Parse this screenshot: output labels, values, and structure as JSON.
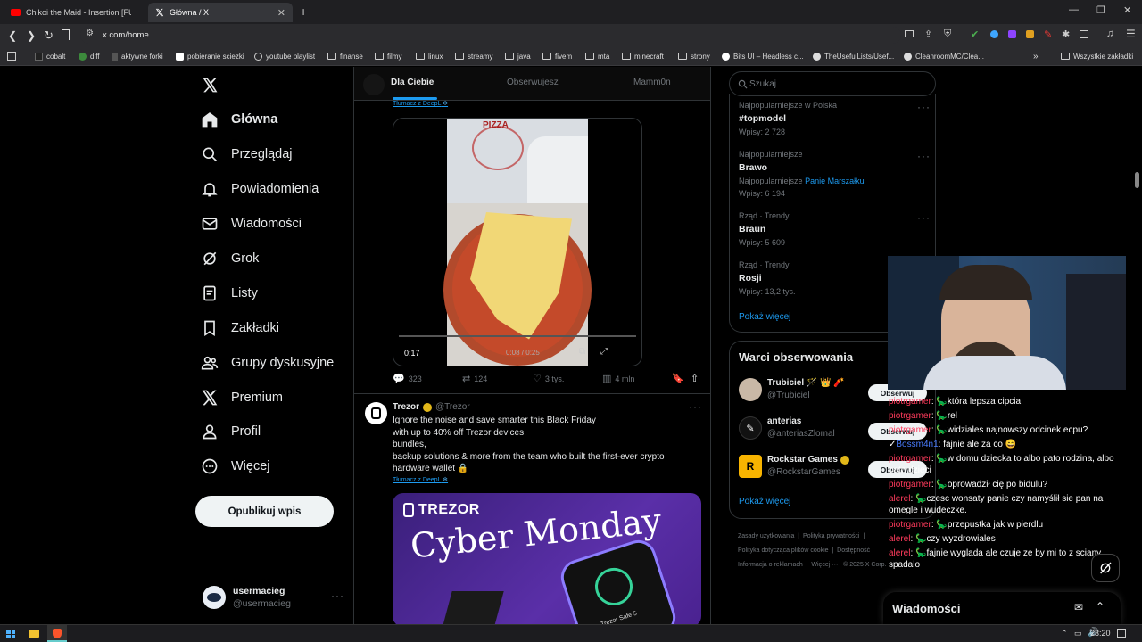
{
  "browser": {
    "tabs": [
      {
        "label": "Chikoi the Maid - Insertion [FULL",
        "icon": "youtube-icon",
        "active": false
      },
      {
        "label": "Główna / X",
        "icon": "x-logo-icon",
        "active": true
      }
    ],
    "url": "x.com/home",
    "bookmarks": [
      "cobalt",
      "diff",
      "aktywne forki",
      "pobieranie sciezki",
      "youtube playlist",
      "finanse",
      "filmy",
      "linux",
      "streamy",
      "java",
      "fivem",
      "mta",
      "minecraft",
      "strony",
      "Bits UI – Headless c...",
      "TheUsefulLists/Usef...",
      "CleanroomMC/Clea..."
    ],
    "all_bookmarks": "Wszystkie zakładki"
  },
  "sidebar": {
    "items": [
      {
        "label": "Główna",
        "icon": "home-icon"
      },
      {
        "label": "Przeglądaj",
        "icon": "search-icon"
      },
      {
        "label": "Powiadomienia",
        "icon": "bell-icon"
      },
      {
        "label": "Wiadomości",
        "icon": "mail-icon"
      },
      {
        "label": "Grok",
        "icon": "grok-icon"
      },
      {
        "label": "Listy",
        "icon": "list-icon"
      },
      {
        "label": "Zakładki",
        "icon": "bookmark-icon"
      },
      {
        "label": "Grupy dyskusyjne",
        "icon": "people-icon"
      },
      {
        "label": "Premium",
        "icon": "x-logo-icon"
      },
      {
        "label": "Profil",
        "icon": "person-icon"
      },
      {
        "label": "Więcej",
        "icon": "more-circle-icon"
      }
    ],
    "post_button": "Opublikuj wpis",
    "account": {
      "name": "usermacieg",
      "handle": "@usermacieg"
    }
  },
  "feed": {
    "tabs": [
      "Dla Ciebie",
      "Obserwujesz",
      "Mamm0n"
    ],
    "translate_label": "Tłumacz z DeepL",
    "video": {
      "time": "0:17",
      "time_right": "0:08 / 0:25",
      "pizza_sign": "PIZZA"
    },
    "stats": {
      "replies": "323",
      "reposts": "124",
      "likes": "3 tys.",
      "views": "4 mln"
    },
    "tweet": {
      "name": "Trezor",
      "handle": "@Trezor",
      "lines": [
        "Ignore the noise and save smarter this Black Friday",
        "with up to 40% off Trezor devices,",
        "bundles,",
        "backup solutions & more from the team who built the first-ever crypto",
        "hardware wallet 🔒"
      ],
      "image_brand": "TREZOR",
      "image_title": "Cyber Monday",
      "device_label": "Trezor Safe 5"
    }
  },
  "right": {
    "search_placeholder": "Szukaj",
    "trends": [
      {
        "meta": "Najpopularniejsze w Polska",
        "name": "#topmodel",
        "count": "Wpisy: 2 728",
        "extra_label": "",
        "extra": ""
      },
      {
        "meta": "Najpopularniejsze",
        "name": "Brawo",
        "count": "Wpisy: 6 194",
        "extra_label": "Najpopularniejsze",
        "extra": "Panie Marszałku"
      },
      {
        "meta": "Rząd · Trendy",
        "name": "Braun",
        "count": "Wpisy: 5 609",
        "extra_label": "",
        "extra": ""
      },
      {
        "meta": "Rząd · Trendy",
        "name": "Rosji",
        "count": "Wpisy: 13,2 tys.",
        "extra_label": "",
        "extra": ""
      }
    ],
    "show_more": "Pokaż więcej",
    "who_to_follow_title": "Warci obserwowania",
    "follow": [
      {
        "name": "Trubiciel 🪄 👑 🧨",
        "handle": "@Trubiciel",
        "button": "Obserwuj"
      },
      {
        "name": "anterias",
        "handle": "@anteriasZlomal",
        "button": "Obserwuj"
      },
      {
        "name": "Rockstar Games",
        "handle": "@RockstarGames",
        "button": "Obserwuj"
      }
    ],
    "show_more2": "Pokaż więcej",
    "footer": [
      "Zasady użytkowania",
      "Polityka prywatności",
      "Polityka dotycząca plików cookie",
      "Dostępność",
      "Informacja o reklamach",
      "Więcej ···",
      "© 2025 X Corp."
    ]
  },
  "chat": {
    "lines": [
      {
        "user": "piotrgamer",
        "color": "#ff3b5c",
        "text": "która lepsza cipcia"
      },
      {
        "user": "piotrgamer",
        "color": "#ff3b5c",
        "text": "rel"
      },
      {
        "user": "piotrgamer",
        "color": "#ff3b5c",
        "text": "widziales najnowszy odcinek ecpu?"
      },
      {
        "user": "Bossm4n1",
        "color": "#4a7dff",
        "text": "fajnie ale za co 😄"
      },
      {
        "user": "piotrgamer",
        "color": "#ff3b5c",
        "text": "w domu dziecka to albo pato rodzina, albo pato dzieci"
      },
      {
        "user": "piotrgamer",
        "color": "#ff3b5c",
        "text": "oprowadził cię po bidulu?"
      },
      {
        "user": "alerel",
        "color": "#ff3b5c",
        "text": "czesc wonsaty panie czy namyślił sie pan na omegle i wudeczke."
      },
      {
        "user": "piotrgamer",
        "color": "#ff3b5c",
        "text": "przepustka jak w pierdlu"
      },
      {
        "user": "alerel",
        "color": "#ff3b5c",
        "text": "czy wyzdrowiales"
      },
      {
        "user": "alerel",
        "color": "#ff3b5c",
        "text": "fajnie wyglada ale czuje ze by mi to z sciany spadalo"
      }
    ]
  },
  "messages_bar": {
    "label": "Wiadomości"
  },
  "taskbar": {
    "time": "23:20"
  }
}
